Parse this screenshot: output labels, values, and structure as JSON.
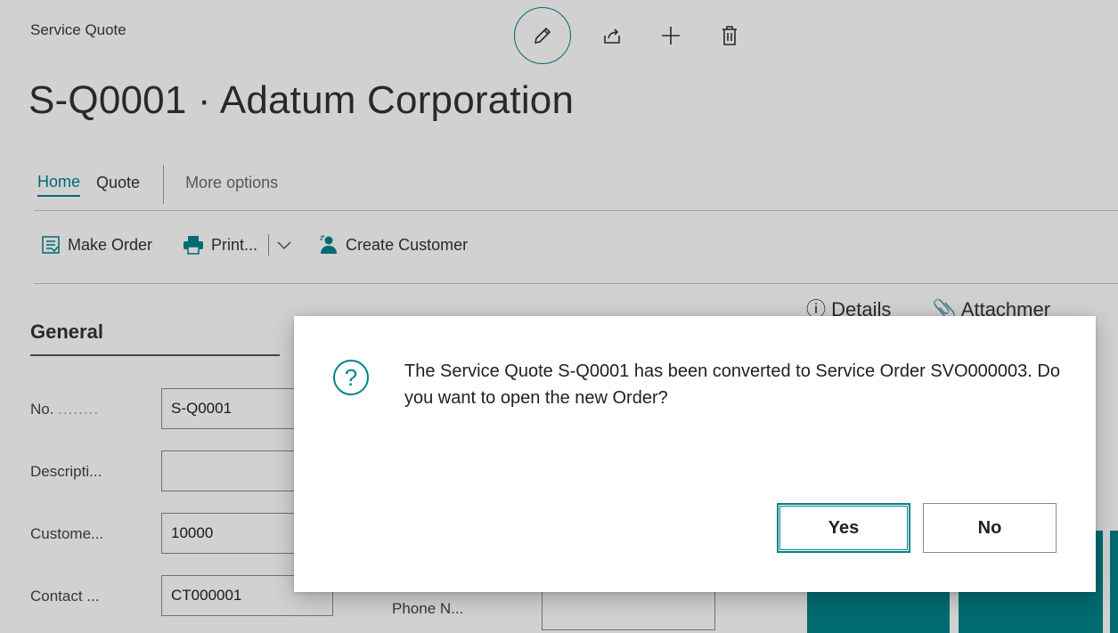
{
  "page": {
    "caption": "Service Quote",
    "title": "S-Q0001 · Adatum Corporation"
  },
  "tabs": [
    {
      "label": "Home",
      "active": true
    },
    {
      "label": "Quote"
    },
    {
      "label": "More options"
    }
  ],
  "actions": {
    "make_order": "Make Order",
    "print": "Print...",
    "create_customer": "Create Customer"
  },
  "general": {
    "title": "General",
    "fields": [
      {
        "label": "No.",
        "value": "S-Q0001"
      },
      {
        "label": "Descripti...",
        "value": ""
      },
      {
        "label": "Custome...",
        "value": "10000"
      },
      {
        "label": "Contact ...",
        "value": "CT000001"
      }
    ],
    "phone_label": "Phone N..."
  },
  "factbox": {
    "details": "Details",
    "attachments": "Attachmer"
  },
  "dialog": {
    "message": "The Service Quote S-Q0001 has been converted to Service Order SVO000003. Do you want to open the new Order?",
    "yes": "Yes",
    "no": "No"
  },
  "colors": {
    "accent": "#00838a",
    "overlay": "rgba(0,0,0,0.18)"
  }
}
